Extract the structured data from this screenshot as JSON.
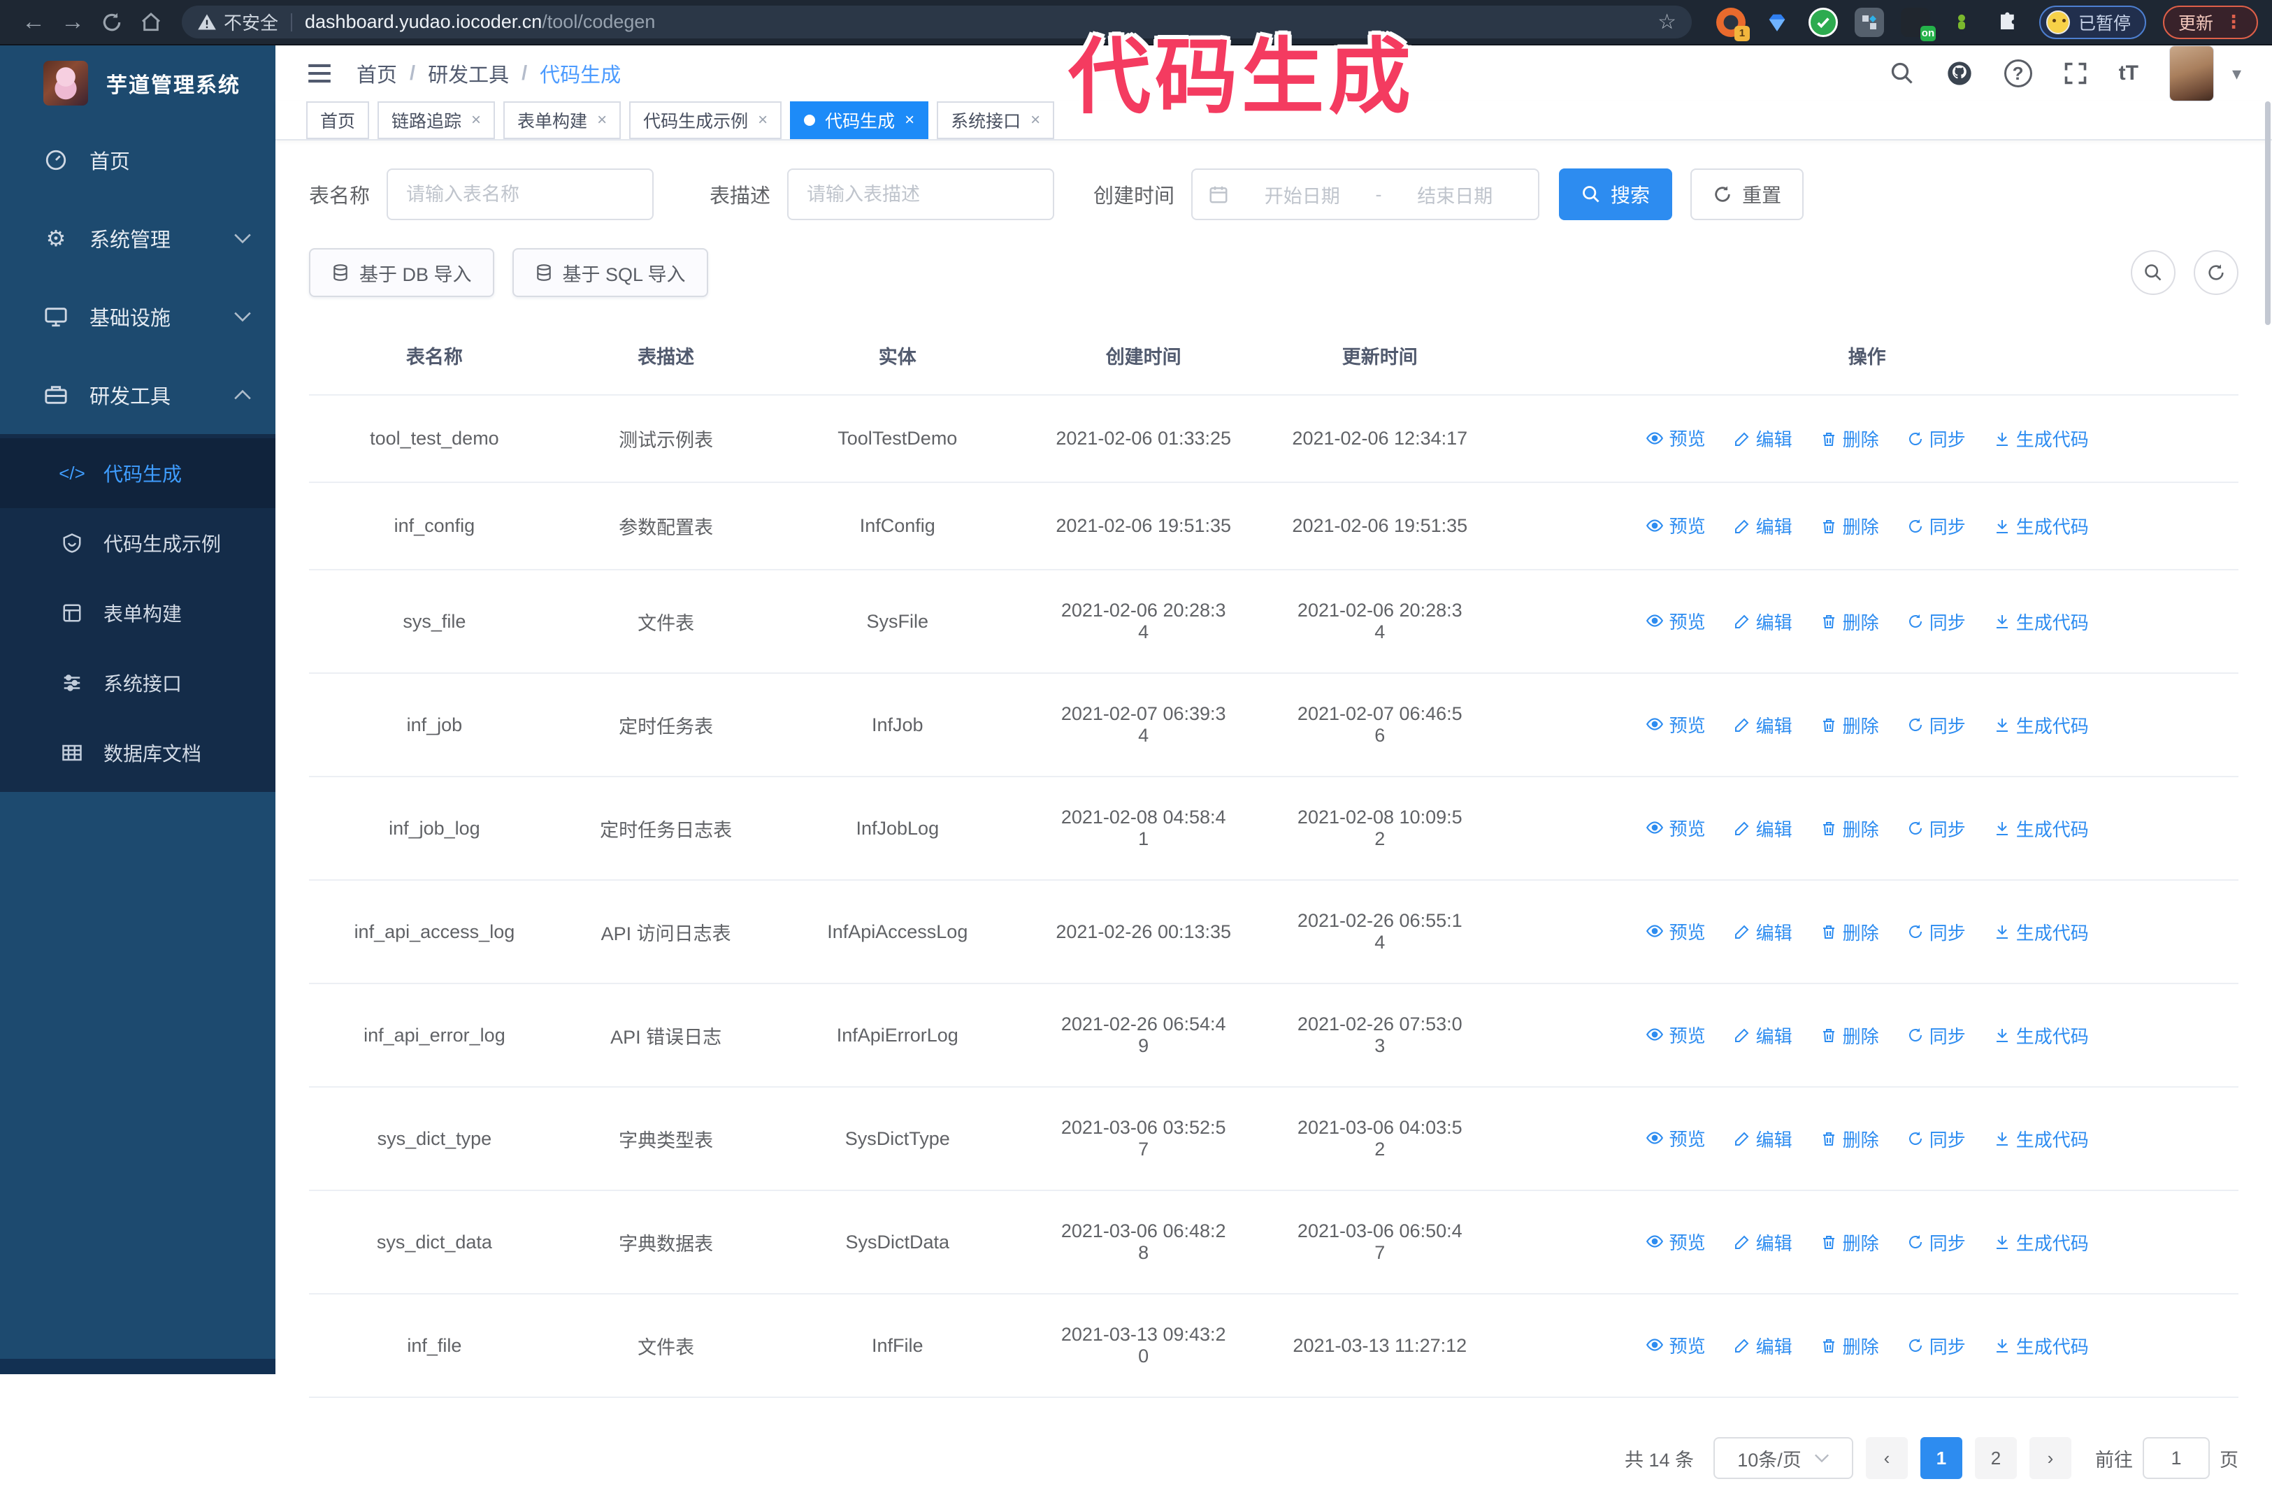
{
  "browser": {
    "security_label": "不安全",
    "url_host": "dashboard.yudao.iocoder.cn",
    "url_path": "/tool/codegen",
    "paused_label": "已暂停",
    "update_label": "更新",
    "ext_badge_on": "on",
    "ext_badge_one": "1"
  },
  "annotation": {
    "text": "代码生成",
    "color": "#f43b60"
  },
  "sidebar": {
    "title": "芋道管理系统",
    "menu": [
      {
        "label": "首页"
      },
      {
        "label": "系统管理"
      },
      {
        "label": "基础设施"
      },
      {
        "label": "研发工具"
      }
    ],
    "submenu": [
      {
        "label": "代码生成"
      },
      {
        "label": "代码生成示例"
      },
      {
        "label": "表单构建"
      },
      {
        "label": "系统接口"
      },
      {
        "label": "数据库文档"
      }
    ]
  },
  "header": {
    "breadcrumb": [
      "首页",
      "研发工具",
      "代码生成"
    ]
  },
  "tabs": [
    {
      "label": "首页"
    },
    {
      "label": "链路追踪"
    },
    {
      "label": "表单构建"
    },
    {
      "label": "代码生成示例"
    },
    {
      "label": "代码生成"
    },
    {
      "label": "系统接口"
    }
  ],
  "search": {
    "name_label": "表名称",
    "name_placeholder": "请输入表名称",
    "desc_label": "表描述",
    "desc_placeholder": "请输入表描述",
    "time_label": "创建时间",
    "start_placeholder": "开始日期",
    "range_separator": "-",
    "end_placeholder": "结束日期",
    "search_button": "搜索",
    "reset_button": "重置"
  },
  "toolbar": {
    "import_db": "基于 DB 导入",
    "import_sql": "基于 SQL 导入"
  },
  "table": {
    "columns": [
      "表名称",
      "表描述",
      "实体",
      "创建时间",
      "更新时间",
      "操作"
    ],
    "actions": [
      "预览",
      "编辑",
      "删除",
      "同步",
      "生成代码"
    ],
    "rows": [
      {
        "name": "tool_test_demo",
        "desc": "测试示例表",
        "entity": "ToolTestDemo",
        "created": "2021-02-06 01:33:25",
        "updated": "2021-02-06 12:34:17"
      },
      {
        "name": "inf_config",
        "desc": "参数配置表",
        "entity": "InfConfig",
        "created": "2021-02-06 19:51:35",
        "updated": "2021-02-06 19:51:35"
      },
      {
        "name": "sys_file",
        "desc": "文件表",
        "entity": "SysFile",
        "created": "2021-02-06 20:28:3\n4",
        "updated": "2021-02-06 20:28:3\n4"
      },
      {
        "name": "inf_job",
        "desc": "定时任务表",
        "entity": "InfJob",
        "created": "2021-02-07 06:39:3\n4",
        "updated": "2021-02-07 06:46:5\n6"
      },
      {
        "name": "inf_job_log",
        "desc": "定时任务日志表",
        "entity": "InfJobLog",
        "created": "2021-02-08 04:58:4\n1",
        "updated": "2021-02-08 10:09:5\n2"
      },
      {
        "name": "inf_api_access_log",
        "desc": "API 访问日志表",
        "entity": "InfApiAccessLog",
        "created": "2021-02-26 00:13:35",
        "updated": "2021-02-26 06:55:1\n4"
      },
      {
        "name": "inf_api_error_log",
        "desc": "API 错误日志",
        "entity": "InfApiErrorLog",
        "created": "2021-02-26 06:54:4\n9",
        "updated": "2021-02-26 07:53:0\n3"
      },
      {
        "name": "sys_dict_type",
        "desc": "字典类型表",
        "entity": "SysDictType",
        "created": "2021-03-06 03:52:5\n7",
        "updated": "2021-03-06 04:03:5\n2"
      },
      {
        "name": "sys_dict_data",
        "desc": "字典数据表",
        "entity": "SysDictData",
        "created": "2021-03-06 06:48:2\n8",
        "updated": "2021-03-06 06:50:4\n7"
      },
      {
        "name": "inf_file",
        "desc": "文件表",
        "entity": "InfFile",
        "created": "2021-03-13 09:43:2\n0",
        "updated": "2021-03-13 11:27:12"
      }
    ]
  },
  "pagination": {
    "total": "共 14 条",
    "page_size": "10条/页",
    "prev": "‹",
    "pages": [
      "1",
      "2"
    ],
    "active_page": "1",
    "next": "›",
    "goto_label": "前往",
    "goto_value": "1",
    "goto_suffix": "页"
  },
  "colors": {
    "accent": "#2d8cf0",
    "sidebar": "#1d4a6f",
    "submenu": "#142c49",
    "active_link": "#3f9dff",
    "annotation": "#f43b60"
  }
}
